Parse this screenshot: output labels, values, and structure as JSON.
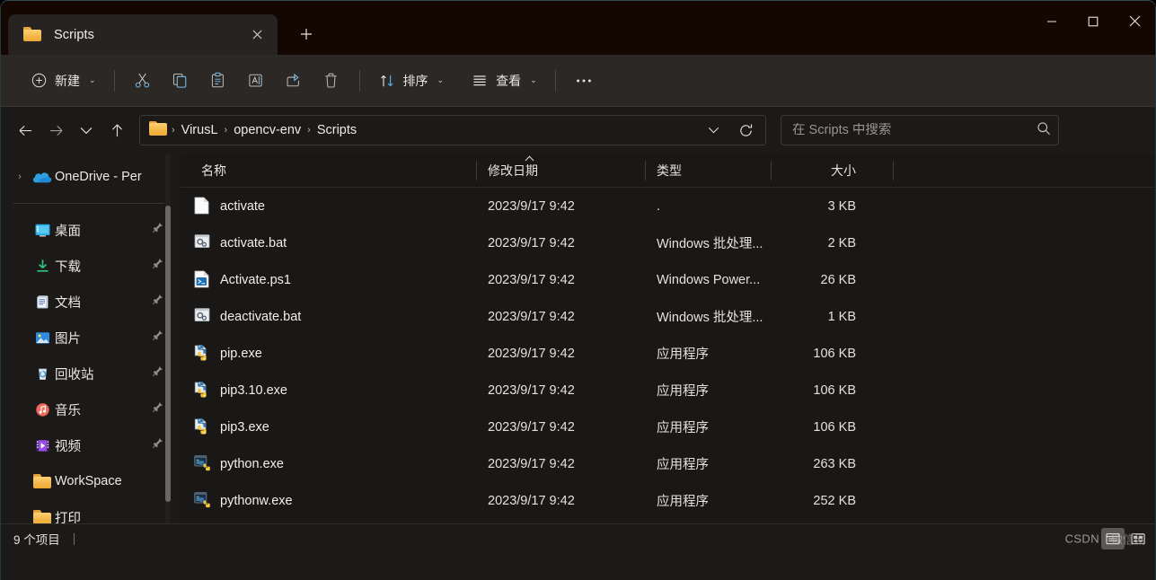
{
  "window": {
    "tab": {
      "title": "Scripts",
      "folder_icon": "folder-icon",
      "close_icon": "close-icon"
    },
    "newtab_label": "+",
    "controls": {
      "minimize": "minimize-icon",
      "maximize": "maximize-icon",
      "close": "close-icon"
    }
  },
  "toolbar": {
    "new_label": "新建",
    "cut_icon": "scissors-icon",
    "copy_icon": "copy-icon",
    "paste_icon": "paste-icon",
    "rename_icon": "rename-icon",
    "share_icon": "share-icon",
    "delete_icon": "trash-icon",
    "sort_label": "排序",
    "view_label": "查看",
    "more_label": "•••"
  },
  "address": {
    "back_icon": "arrow-left-icon",
    "forward_icon": "arrow-right-icon",
    "recent_icon": "chevron-down-icon",
    "up_icon": "arrow-up-icon",
    "breadcrumbs": [
      "VirusL",
      "opencv-env",
      "Scripts"
    ],
    "separator": "›",
    "dropdown_icon": "chevron-down-icon",
    "refresh_icon": "refresh-icon"
  },
  "search": {
    "placeholder": "在 Scripts 中搜索",
    "value": "",
    "icon": "search-icon"
  },
  "sidebar": {
    "items": [
      {
        "label": "OneDrive - Per",
        "icon": "onedrive-icon",
        "expandable": true,
        "pinned": false
      },
      {
        "label": "桌面",
        "icon": "desktop-icon",
        "expandable": false,
        "pinned": true
      },
      {
        "label": "下载",
        "icon": "downloads-icon",
        "expandable": false,
        "pinned": true
      },
      {
        "label": "文档",
        "icon": "documents-icon",
        "expandable": false,
        "pinned": true
      },
      {
        "label": "图片",
        "icon": "pictures-icon",
        "expandable": false,
        "pinned": true
      },
      {
        "label": "回收站",
        "icon": "recyclebin-icon",
        "expandable": false,
        "pinned": true
      },
      {
        "label": "音乐",
        "icon": "music-icon",
        "expandable": false,
        "pinned": true
      },
      {
        "label": "视频",
        "icon": "video-icon",
        "expandable": false,
        "pinned": true
      },
      {
        "label": "WorkSpace",
        "icon": "folder-icon",
        "expandable": false,
        "pinned": false
      },
      {
        "label": "打印",
        "icon": "folder-icon",
        "expandable": false,
        "pinned": false
      }
    ]
  },
  "filelist": {
    "columns": {
      "name": "名称",
      "date": "修改日期",
      "type": "类型",
      "size": "大小"
    },
    "sort": {
      "column": "名称",
      "direction": "asc",
      "caret": "⌃"
    },
    "rows": [
      {
        "name": "activate",
        "date": "2023/9/17 9:42",
        "type": ".",
        "size": "3 KB",
        "icon": "blank-file-icon"
      },
      {
        "name": "activate.bat",
        "date": "2023/9/17 9:42",
        "type": "Windows 批处理...",
        "size": "2 KB",
        "icon": "bat-file-icon"
      },
      {
        "name": "Activate.ps1",
        "date": "2023/9/17 9:42",
        "type": "Windows Power...",
        "size": "26 KB",
        "icon": "ps1-file-icon"
      },
      {
        "name": "deactivate.bat",
        "date": "2023/9/17 9:42",
        "type": "Windows 批处理...",
        "size": "1 KB",
        "icon": "bat-file-icon"
      },
      {
        "name": "pip.exe",
        "date": "2023/9/17 9:42",
        "type": "应用程序",
        "size": "106 KB",
        "icon": "python-exe-icon"
      },
      {
        "name": "pip3.10.exe",
        "date": "2023/9/17 9:42",
        "type": "应用程序",
        "size": "106 KB",
        "icon": "python-exe-icon"
      },
      {
        "name": "pip3.exe",
        "date": "2023/9/17 9:42",
        "type": "应用程序",
        "size": "106 KB",
        "icon": "python-exe-icon"
      },
      {
        "name": "python.exe",
        "date": "2023/9/17 9:42",
        "type": "应用程序",
        "size": "263 KB",
        "icon": "python-console-icon"
      },
      {
        "name": "pythonw.exe",
        "date": "2023/9/17 9:42",
        "type": "应用程序",
        "size": "252 KB",
        "icon": "python-console-icon"
      }
    ]
  },
  "statusbar": {
    "item_count": "9 个项目",
    "separator": "|",
    "details_view_icon": "details-view-icon",
    "large_icons_view_icon": "large-icons-view-icon"
  },
  "watermark": {
    "text": "CSDN",
    "text2": "微信网"
  },
  "colors": {
    "titlebar_bg": "#140702",
    "tab_bg": "#262322",
    "toolbar_bg": "#2b2826",
    "pane_bg": "#191817",
    "sidebar_bg": "#1c1a19",
    "text": "#f1efed",
    "accent_blue": "#4cc2ff",
    "folder_yellow": "#f3b74a"
  }
}
